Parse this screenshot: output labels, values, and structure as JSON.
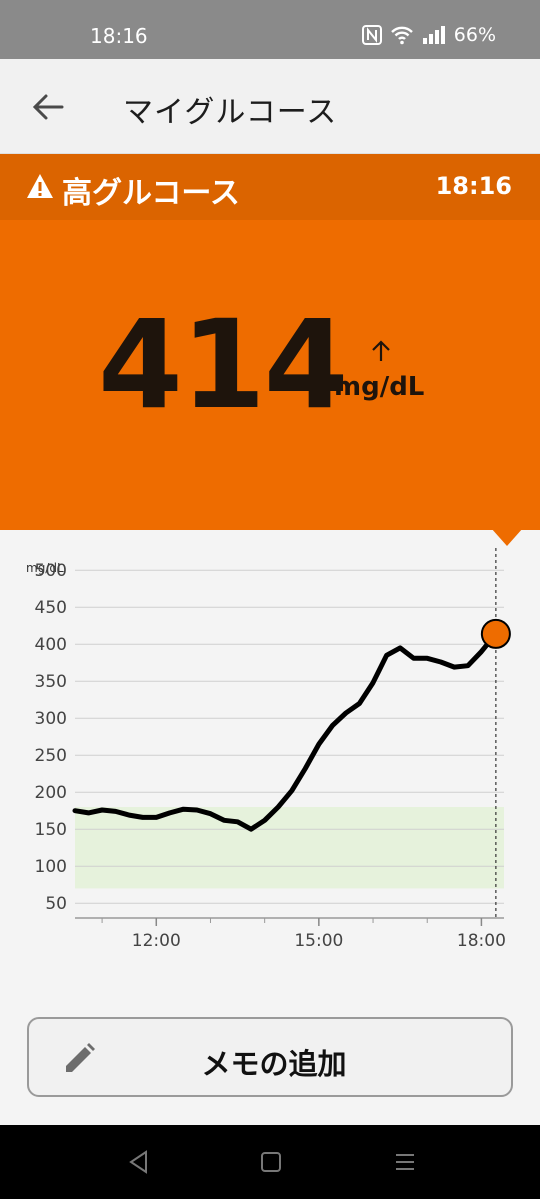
{
  "status_bar": {
    "time": "18:16",
    "battery": "66%"
  },
  "app_bar": {
    "title": "マイグルコース"
  },
  "alert": {
    "title": "高グルコース",
    "time": "18:16"
  },
  "reading": {
    "value": "414",
    "unit": "mg/dL",
    "trend": "rising"
  },
  "colors": {
    "orange": "#ee6c00",
    "alert_bar": "#db6400",
    "target_range": "#e6f2dc"
  },
  "chart_data": {
    "type": "line",
    "ylabel": "mg/dL",
    "yticks": [
      500,
      450,
      400,
      350,
      300,
      250,
      200,
      150,
      100,
      50
    ],
    "ylim": [
      30,
      530
    ],
    "xticks": [
      "12:00",
      "15:00",
      "18:00"
    ],
    "target_range": [
      70,
      180
    ],
    "grid": true,
    "x": [
      "10:30",
      "10:45",
      "11:00",
      "11:15",
      "11:30",
      "11:45",
      "12:00",
      "12:15",
      "12:30",
      "12:45",
      "13:00",
      "13:15",
      "13:30",
      "13:45",
      "14:00",
      "14:15",
      "14:30",
      "14:45",
      "15:00",
      "15:15",
      "15:30",
      "15:45",
      "16:00",
      "16:15",
      "16:30",
      "16:45",
      "17:00",
      "17:15",
      "17:30",
      "17:45",
      "18:00",
      "18:16"
    ],
    "values": [
      175,
      172,
      176,
      174,
      169,
      166,
      166,
      172,
      177,
      176,
      171,
      162,
      160,
      150,
      162,
      180,
      202,
      232,
      265,
      290,
      307,
      320,
      348,
      385,
      395,
      381,
      381,
      376,
      369,
      371,
      390,
      414
    ]
  },
  "memo_button": {
    "label": "メモの追加"
  },
  "icons": {
    "back": "arrow-left-icon",
    "warning": "warning-icon",
    "trend": "arrow-up-icon",
    "memo": "pencil-icon"
  }
}
